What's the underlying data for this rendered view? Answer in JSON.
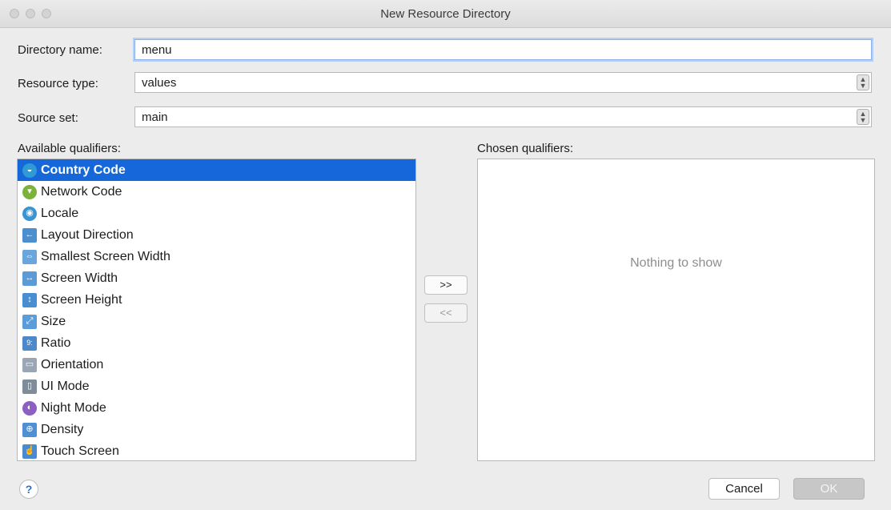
{
  "window": {
    "title": "New Resource Directory"
  },
  "form": {
    "directory_name_label": "Directory name:",
    "directory_name_value": "menu",
    "resource_type_label": "Resource type:",
    "resource_type_value": "values",
    "source_set_label": "Source set:",
    "source_set_value": "main"
  },
  "qualifiers": {
    "available_label": "Available qualifiers:",
    "chosen_label": "Chosen qualifiers:",
    "empty_text": "Nothing to show",
    "add_label": ">>",
    "remove_label": "<<",
    "items": [
      {
        "label": "Country Code",
        "icon": "country-code-icon",
        "selected": true
      },
      {
        "label": "Network Code",
        "icon": "network-code-icon"
      },
      {
        "label": "Locale",
        "icon": "locale-icon"
      },
      {
        "label": "Layout Direction",
        "icon": "layout-direction-icon"
      },
      {
        "label": "Smallest Screen Width",
        "icon": "smallest-screen-width-icon"
      },
      {
        "label": "Screen Width",
        "icon": "screen-width-icon"
      },
      {
        "label": "Screen Height",
        "icon": "screen-height-icon"
      },
      {
        "label": "Size",
        "icon": "size-icon"
      },
      {
        "label": "Ratio",
        "icon": "ratio-icon"
      },
      {
        "label": "Orientation",
        "icon": "orientation-icon"
      },
      {
        "label": "UI Mode",
        "icon": "ui-mode-icon"
      },
      {
        "label": "Night Mode",
        "icon": "night-mode-icon"
      },
      {
        "label": "Density",
        "icon": "density-icon"
      },
      {
        "label": "Touch Screen",
        "icon": "touch-screen-icon"
      }
    ]
  },
  "footer": {
    "help_label": "?",
    "cancel_label": "Cancel",
    "ok_label": "OK"
  }
}
